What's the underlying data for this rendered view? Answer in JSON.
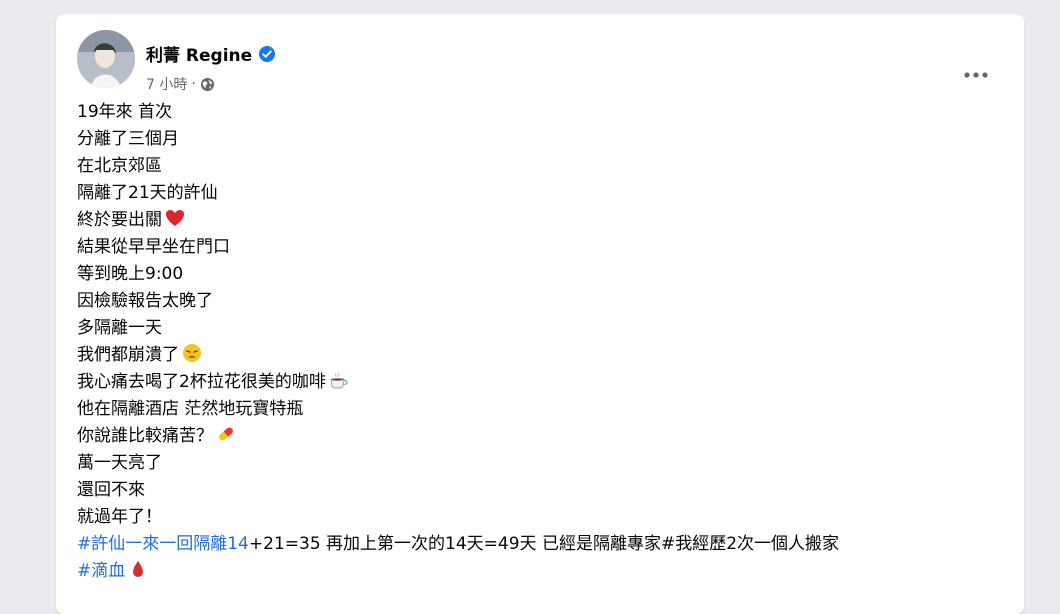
{
  "author": {
    "name": "利菁 Regine",
    "verified_icon": "verified-badge-icon",
    "time": "7 小時",
    "separator": "·",
    "privacy_icon": "globe-icon"
  },
  "menu": {
    "icon": "more-options-icon"
  },
  "post": {
    "lines": [
      "19年來 首次",
      "分離了三個月",
      "在北京郊區",
      "隔離了21天的許仙",
      "終於要出關",
      "結果從早早坐在門口",
      "等到晚上9:00",
      "因檢驗報告太晚了",
      "多隔離一天",
      "我們都崩潰了",
      "我心痛去喝了2杯拉花很美的咖啡",
      "他在隔離酒店 茫然地玩寶特瓶",
      "你說誰比較痛苦？",
      "萬一天亮了",
      "還回不來",
      "就過年了！"
    ],
    "hashtag1": "#許仙一來一回隔離14",
    "line17_rest": "+21=35 再加上第一次的14天=49天 已經是隔離專家#我經歷2次一個人搬家",
    "hashtag2": "#滴血"
  },
  "colors": {
    "link": "#216fdb",
    "text": "#050505",
    "secondary": "#65676b",
    "verified": "#1877f2"
  }
}
